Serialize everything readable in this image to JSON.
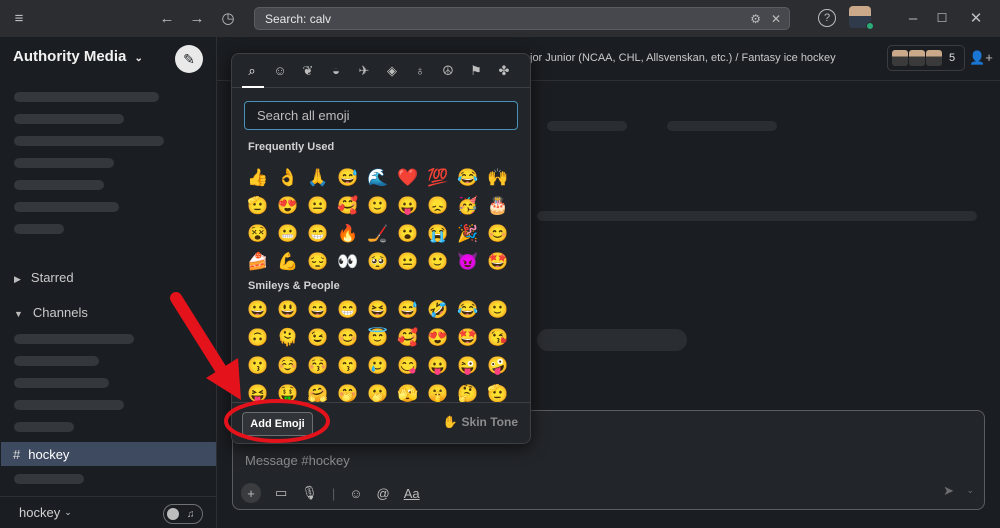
{
  "topbar": {
    "search_text": "Search: calv",
    "icons": [
      "hamburger-icon",
      "back-arrow-icon",
      "forward-arrow-icon",
      "history-icon",
      "filter-icon",
      "close-icon",
      "help-icon",
      "minimize-icon",
      "maximize-icon",
      "window-close-icon"
    ]
  },
  "sidebar": {
    "workspace_name": "Authority Media",
    "sections": {
      "starred_label": "Starred",
      "channels_label": "Channels"
    },
    "active_channel": "hockey",
    "bottom_channel": "hockey"
  },
  "main": {
    "channel_topic": "jor Junior (NCAA, CHL, Allsvenskan, etc.) / Fantasy ice hockey",
    "member_count": "5",
    "message_placeholder": "Message #hockey",
    "composer_tools": [
      "plus-icon",
      "video-icon",
      "microphone-icon",
      "emoji-icon",
      "mention-icon",
      "formatting-icon"
    ],
    "format_label": "Aa"
  },
  "emoji_picker": {
    "categories": [
      "search",
      "smileys",
      "nature",
      "food",
      "travel",
      "activity",
      "objects",
      "symbols",
      "flags",
      "slack"
    ],
    "search_placeholder": "Search all emoji",
    "frequently_used_title": "Frequently Used",
    "frequently_used": [
      "👍",
      "👌",
      "🙏",
      "😅",
      "🌊",
      "❤️",
      "💯",
      "😂",
      "🙌",
      "🫡",
      "😍",
      "😐",
      "🥰",
      "🙂",
      "😛",
      "😞",
      "🥳",
      "🎂",
      "😵",
      "😬",
      "😁",
      "🔥",
      "🏒",
      "😮",
      "😭",
      "🎉",
      "😊",
      "🍰",
      "💪",
      "😔",
      "👀",
      "🥺",
      "😐",
      "🙂",
      "😈",
      "🤩"
    ],
    "smileys_title": "Smileys & People",
    "smileys": [
      "😀",
      "😃",
      "😄",
      "😁",
      "😆",
      "😅",
      "🤣",
      "😂",
      "🙂",
      "🙃",
      "🫠",
      "😉",
      "😊",
      "😇",
      "🥰",
      "😍",
      "🤩",
      "😘",
      "😗",
      "☺️",
      "😚",
      "😙",
      "🥲",
      "😋",
      "😛",
      "😜",
      "🤪",
      "😝",
      "🤑",
      "🤗",
      "🤭",
      "🫢",
      "🫣",
      "🤫",
      "🤔",
      "🫡"
    ],
    "add_emoji_label": "Add Emoji",
    "skin_tone_label": "Skin Tone"
  },
  "colors": {
    "annotation": "#e3121b",
    "active_channel_bg": "#3d4a60",
    "search_focus": "#4a90b8"
  }
}
